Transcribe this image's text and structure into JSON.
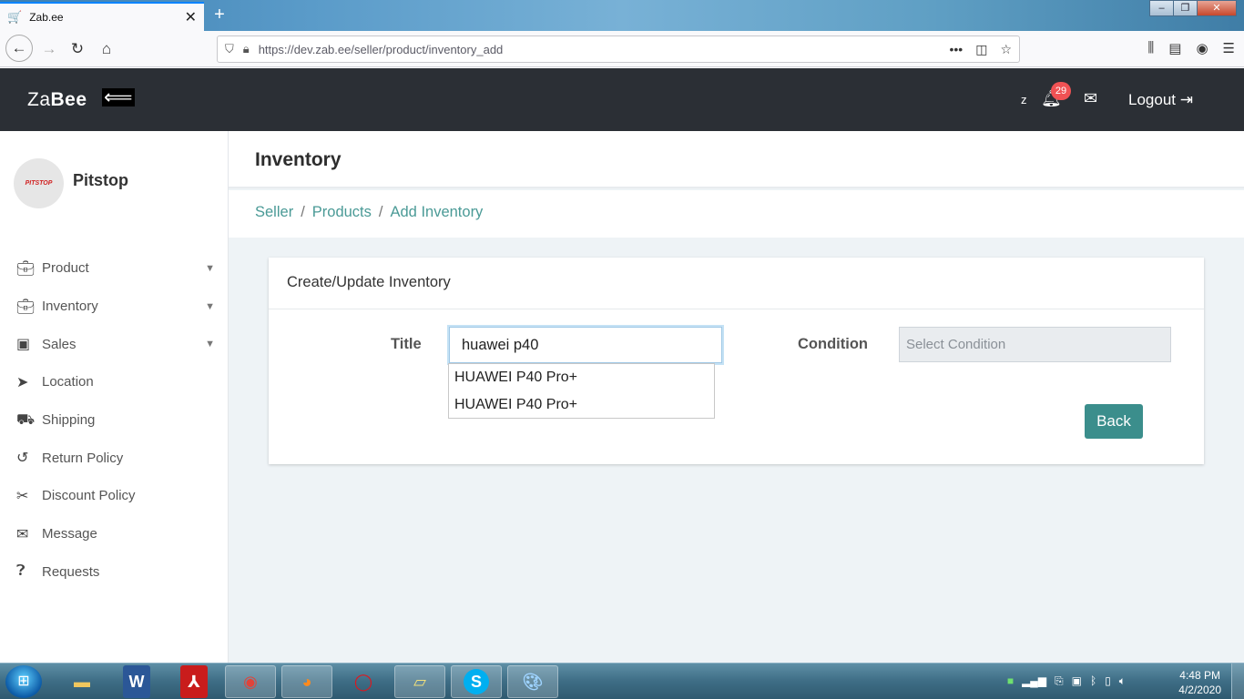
{
  "browser": {
    "tab_title": "Zab.ee",
    "new_tab": "+",
    "url": "https://dev.zab.ee/seller/product/inventory_add"
  },
  "header": {
    "brand_light": "Za",
    "brand_bold": "Bee",
    "user_initial": "z",
    "notification_count": "29",
    "logout_label": "Logout"
  },
  "sidebar": {
    "store_logo_text": "PITSTOP",
    "store_name": "Pitstop",
    "items": [
      {
        "label": "Product",
        "icon": "briefcase-icon"
      },
      {
        "label": "Inventory",
        "icon": "briefcase-icon"
      },
      {
        "label": "Sales",
        "icon": "money-icon"
      },
      {
        "label": "Location",
        "icon": "location-arrow-icon"
      },
      {
        "label": "Shipping",
        "icon": "truck-icon"
      },
      {
        "label": "Return Policy",
        "icon": "undo-icon"
      },
      {
        "label": "Discount Policy",
        "icon": "scissors-icon"
      },
      {
        "label": "Message",
        "icon": "envelope-icon"
      },
      {
        "label": "Requests",
        "icon": "question-circle-icon"
      }
    ]
  },
  "page": {
    "title": "Inventory",
    "breadcrumb": [
      "Seller",
      "Products",
      "Add Inventory"
    ],
    "card_title": "Create/Update Inventory",
    "title_label": "Title",
    "title_value": "huawei p40",
    "suggestions": [
      "HUAWEI P40 Pro+",
      "HUAWEI P40 Pro+"
    ],
    "condition_label": "Condition",
    "condition_placeholder": "Select Condition",
    "back_label": "Back"
  },
  "taskbar": {
    "time": "4:48 PM",
    "date": "4/2/2020"
  },
  "colors": {
    "header_bg": "#2b2f35",
    "accent_teal": "#3b8e8c",
    "breadcrumb_link": "#4a9a96",
    "badge_red": "#f05254"
  }
}
